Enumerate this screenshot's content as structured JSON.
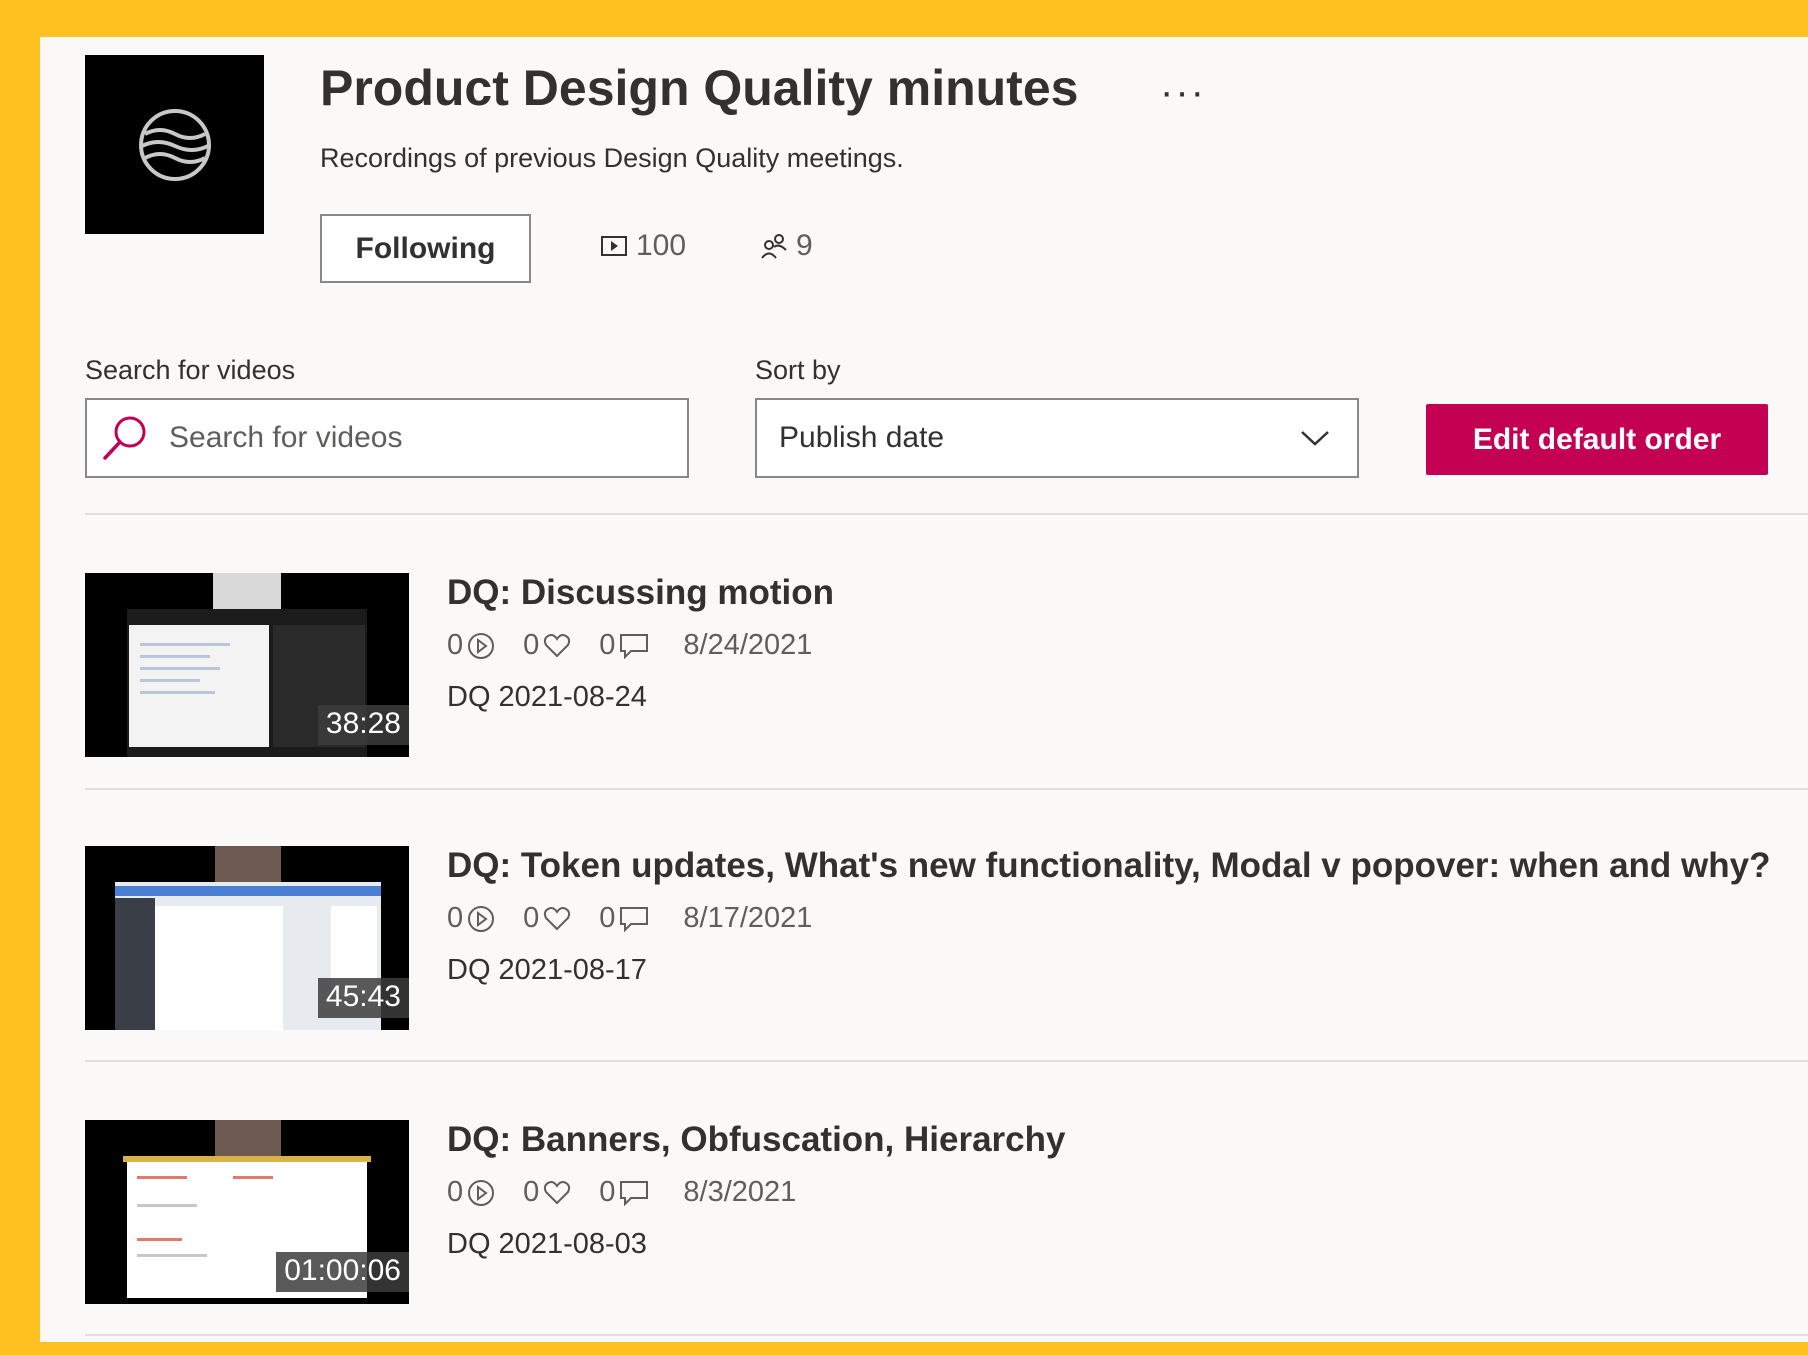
{
  "colors": {
    "frame": "#ffc11f",
    "accent": "#c30052",
    "panel_bg": "#faf9f8",
    "text": "#323130"
  },
  "channel": {
    "title": "Product Design Quality minutes",
    "description": "Recordings of previous Design Quality meetings.",
    "more_label": "···",
    "follow_label": "Following",
    "video_count": "100",
    "follower_count": "9",
    "logo_icon": "waves-icon"
  },
  "controls": {
    "search_label": "Search for videos",
    "search_placeholder": "Search for videos",
    "search_value": "",
    "sort_label": "Sort by",
    "sort_value": "Publish date",
    "edit_order_label": "Edit default order"
  },
  "videos": [
    {
      "title": "DQ: Discussing motion",
      "views": "0",
      "likes": "0",
      "comments": "0",
      "date": "8/24/2021",
      "subtitle": "DQ 2021-08-24",
      "duration": "38:28"
    },
    {
      "title": "DQ: Token updates, What's new functionality, Modal v popover: when and why?",
      "views": "0",
      "likes": "0",
      "comments": "0",
      "date": "8/17/2021",
      "subtitle": "DQ 2021-08-17",
      "duration": "45:43"
    },
    {
      "title": "DQ: Banners, Obfuscation, Hierarchy",
      "views": "0",
      "likes": "0",
      "comments": "0",
      "date": "8/3/2021",
      "subtitle": "DQ 2021-08-03",
      "duration": "01:00:06"
    }
  ]
}
